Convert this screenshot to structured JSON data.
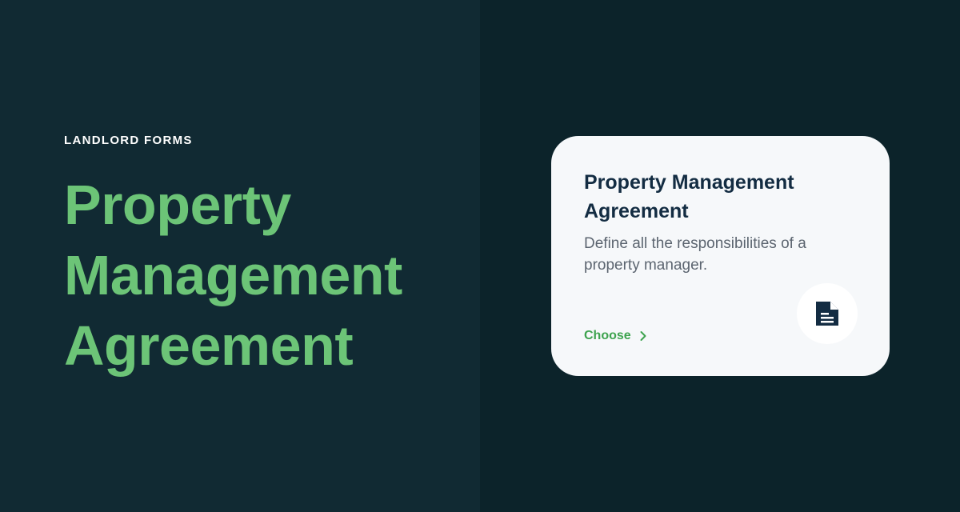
{
  "hero": {
    "eyebrow": "LANDLORD FORMS",
    "title_lines": [
      "Property",
      "Management",
      "Agreement"
    ]
  },
  "card": {
    "title": "Property Management Agreement",
    "description": "Define all the responsibilities of a property manager.",
    "cta_label": "Choose",
    "icon": "document-icon"
  },
  "colors": {
    "left_bg": "#112a33",
    "right_bg": "#0c232a",
    "accent_green": "#6cc477",
    "link_green": "#3ea34f",
    "card_bg": "#f6f8fa",
    "card_title": "#132c42"
  }
}
